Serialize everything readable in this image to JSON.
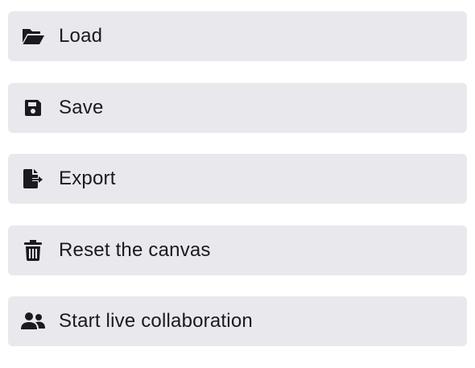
{
  "menu": {
    "items": [
      {
        "label": "Load",
        "icon": "folder-open-icon"
      },
      {
        "label": "Save",
        "icon": "floppy-disk-icon"
      },
      {
        "label": "Export",
        "icon": "file-export-icon"
      },
      {
        "label": "Reset the canvas",
        "icon": "trash-icon"
      },
      {
        "label": "Start live collaboration",
        "icon": "users-icon"
      }
    ]
  },
  "colors": {
    "item_background": "#e9e9ed",
    "text": "#1b1b1f"
  }
}
